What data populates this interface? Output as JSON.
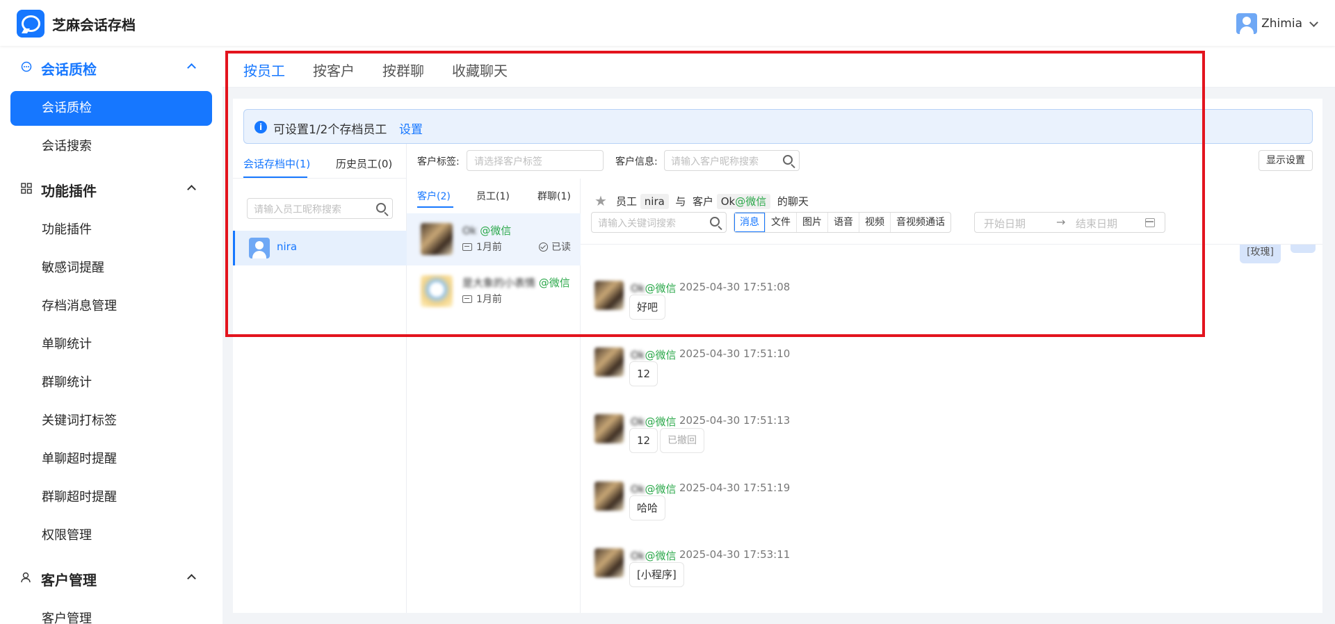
{
  "app": {
    "brand": "芝麻会话存档",
    "user": "Zhimia"
  },
  "sidebar": {
    "groups": [
      {
        "label": "会话质检",
        "icon": "chat-bubble-icon"
      },
      {
        "label": "功能插件",
        "icon": "grid-icon"
      },
      {
        "label": "客户管理",
        "icon": "person-icon"
      }
    ],
    "items": [
      "会话质检",
      "会话搜索",
      "功能插件",
      "敏感词提醒",
      "存档消息管理",
      "单聊统计",
      "群聊统计",
      "关键词打标签",
      "单聊超时提醒",
      "群聊超时提醒",
      "权限管理",
      "客户管理"
    ]
  },
  "tabs": [
    "按员工",
    "按客户",
    "按群聊",
    "收藏聊天"
  ],
  "notice": {
    "text": "可设置1/2个存档员工",
    "link": "设置"
  },
  "employees": {
    "tabs": [
      "会话存档中(1)",
      "历史员工(0)"
    ],
    "search_placeholder": "请输入员工昵称搜索",
    "list": [
      {
        "name": "nira"
      }
    ]
  },
  "filters": {
    "tag_label": "客户标签:",
    "tag_placeholder": "请选择客户标签",
    "info_label": "客户信息:",
    "info_placeholder": "请输入客户昵称搜索",
    "display_button": "显示设置"
  },
  "conversations": {
    "tabs": [
      "客户(2)",
      "员工(1)",
      "群聊(1)"
    ],
    "list": [
      {
        "name": "Ok",
        "suffix": "@微信",
        "time": "1月前",
        "status": "已读"
      },
      {
        "name": "是大象的小表情",
        "suffix": "@微信",
        "time": "1月前",
        "status": ""
      }
    ]
  },
  "chat": {
    "header": {
      "employee_label": "员工",
      "employee": "nira",
      "with": "与",
      "customer_label": "客户",
      "customer": "Ok",
      "customer_suffix": "@微信",
      "tail": "的聊天"
    },
    "search_placeholder": "请输入关键词搜索",
    "types": [
      "消息",
      "文件",
      "图片",
      "语音",
      "视频",
      "音视频通话"
    ],
    "date_start": "开始日期",
    "date_end": "结束日期",
    "top_bubble": "[玫瑰]",
    "messages": [
      {
        "sender": "Ok",
        "suffix": "@微信",
        "time": "2025-04-30 17:51:08",
        "text": "好吧",
        "recalled": ""
      },
      {
        "sender": "Ok",
        "suffix": "@微信",
        "time": "2025-04-30 17:51:10",
        "text": "12",
        "recalled": ""
      },
      {
        "sender": "Ok",
        "suffix": "@微信",
        "time": "2025-04-30 17:51:13",
        "text": "12",
        "recalled": "已撤回"
      },
      {
        "sender": "Ok",
        "suffix": "@微信",
        "time": "2025-04-30 17:51:19",
        "text": "哈哈",
        "recalled": ""
      },
      {
        "sender": "Ok",
        "suffix": "@微信",
        "time": "2025-04-30 17:53:11",
        "text": "[小程序]",
        "recalled": ""
      }
    ]
  },
  "colors": {
    "accent": "#1677ff",
    "highlight_border": "#e3141e",
    "wechat_green": "#2ba84a"
  }
}
